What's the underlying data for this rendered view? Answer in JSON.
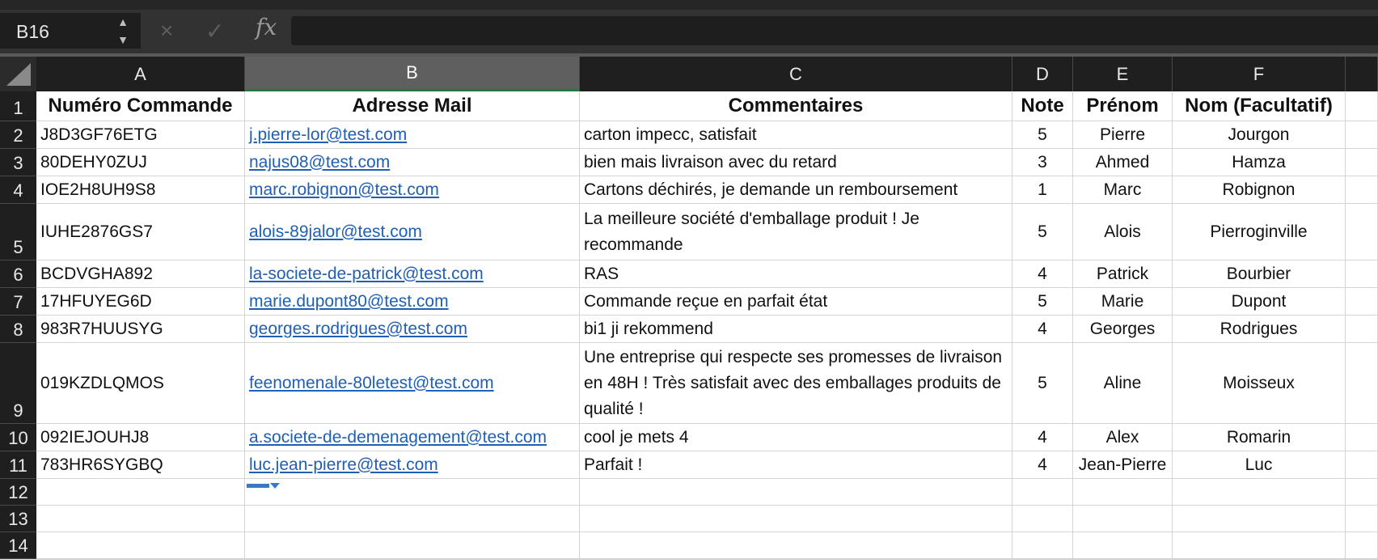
{
  "name_box": "B16",
  "formula_bar": {
    "fx_label": "fx",
    "cancel_icon": "×",
    "confirm_icon": "✓",
    "value": ""
  },
  "columns": [
    "A",
    "B",
    "C",
    "D",
    "E",
    "F"
  ],
  "rows": [
    "1",
    "2",
    "3",
    "4",
    "5",
    "6",
    "7",
    "8",
    "9",
    "10",
    "11",
    "12",
    "13",
    "14"
  ],
  "table": {
    "headers": [
      "Numéro Commande",
      "Adresse Mail",
      "Commentaires",
      "Note",
      "Prénom",
      "Nom (Facultatif)"
    ],
    "records": [
      [
        "J8D3GF76ETG",
        "j.pierre-lor@test.com",
        "carton impecc, satisfait",
        "5",
        "Pierre",
        "Jourgon"
      ],
      [
        "80DEHY0ZUJ",
        "najus08@test.com",
        "bien mais livraison avec du retard",
        "3",
        "Ahmed",
        "Hamza"
      ],
      [
        "IOE2H8UH9S8",
        "marc.robignon@test.com",
        "Cartons déchirés, je demande un remboursement",
        "1",
        "Marc",
        "Robignon"
      ],
      [
        "IUHE2876GS7",
        "alois-89jalor@test.com",
        "La meilleure société d'emballage produit ! Je recommande",
        "5",
        "Alois",
        "Pierroginville"
      ],
      [
        "BCDVGHA892",
        "la-societe-de-patrick@test.com",
        "RAS",
        "4",
        "Patrick",
        "Bourbier"
      ],
      [
        "17HFUYEG6D",
        "marie.dupont80@test.com",
        "Commande reçue en parfait état",
        "5",
        "Marie",
        "Dupont"
      ],
      [
        "983R7HUUSYG",
        "georges.rodrigues@test.com",
        "bi1 ji rekommend",
        "4",
        "Georges",
        "Rodrigues"
      ],
      [
        "019KZDLQMOS",
        "feenomenale-80letest@test.com",
        "Une entreprise qui respecte ses promesses de livraison en 48H ! Très satisfait avec des emballages produits de qualité !",
        "5",
        "Aline",
        "Moisseux"
      ],
      [
        "092IEJOUHJ8",
        "a.societe-de-demenagement@test.com",
        "cool je mets 4",
        "4",
        "Alex",
        "Romarin"
      ],
      [
        "783HR6SYGBQ",
        "luc.jean-pierre@test.com",
        "Parfait !",
        "4",
        "Jean-Pierre",
        "Luc"
      ]
    ]
  },
  "selected_cell": {
    "column": "B",
    "row": "16"
  },
  "colors": {
    "link": "#1f5fb4",
    "selection_accent": "#1d7a43",
    "fill_handle": "#3b78c4",
    "header_bg": "#1f1f1f"
  }
}
